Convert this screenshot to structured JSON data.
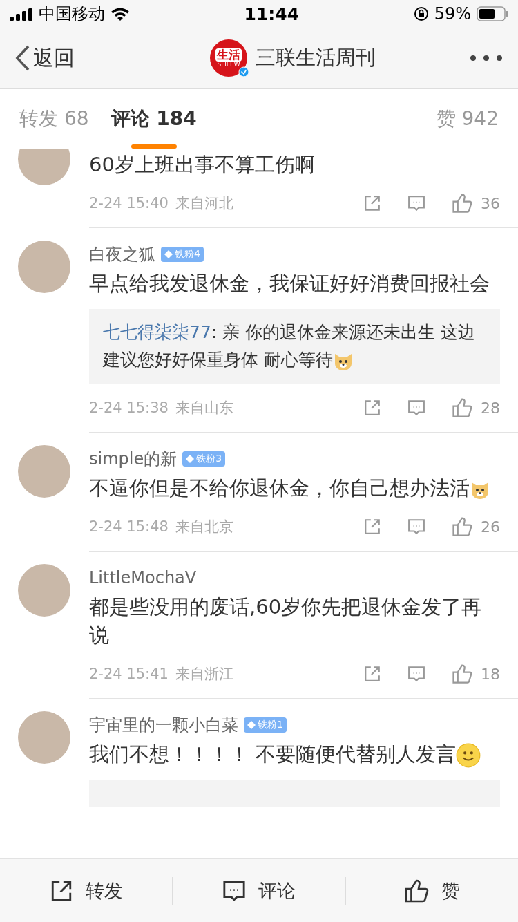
{
  "status_bar": {
    "carrier": "中国移动",
    "time": "11:44",
    "battery": "59%"
  },
  "nav": {
    "back": "返回",
    "title": "三联生活周刊",
    "logo_text": "生活",
    "logo_sub": "SLIFEW"
  },
  "tabs": [
    {
      "label": "转发 68",
      "selected": false
    },
    {
      "label": "评论 184",
      "selected": true
    },
    {
      "label": "赞 942",
      "selected": false
    }
  ],
  "comments": [
    {
      "text": "60岁上班出事不算工伤啊",
      "time": "2-24 15:40",
      "location": "来自河北",
      "likes": "36"
    },
    {
      "name": "白夜之狐",
      "badge": "铁粉4",
      "text": "早点给我发退休金，我保证好好消费回报社会",
      "reply": {
        "user": "七七得柒柒77",
        "text": ": 亲 你的退休金来源还未出生 这边建议您好好保重身体  耐心等待",
        "emoji": {
          "kind": "doge"
        }
      },
      "time": "2-24 15:38",
      "location": "来自山东",
      "likes": "28"
    },
    {
      "name": "simple的新",
      "badge": "铁粉3",
      "text": "不逼你但是不给你退休金，你自己想办法活",
      "emoji": {
        "kind": "doge"
      },
      "time": "2-24 15:48",
      "location": "来自北京",
      "likes": "26"
    },
    {
      "name": "LittleMochaV",
      "text": "都是些没用的废话,60岁你先把退休金发了再说",
      "time": "2-24 15:41",
      "location": "来自浙江",
      "likes": "18"
    },
    {
      "name": "宇宙里的一颗小白菜",
      "badge": "铁粉1",
      "text": "我们不想！！！！ 不要随便代替别人发言",
      "emoji": {
        "kind": "smile"
      },
      "reply_cut": true
    }
  ],
  "bottom_bar": [
    {
      "label": "转发",
      "kind": "share"
    },
    {
      "label": "评论",
      "kind": "comment"
    },
    {
      "label": "赞",
      "kind": "like"
    }
  ]
}
